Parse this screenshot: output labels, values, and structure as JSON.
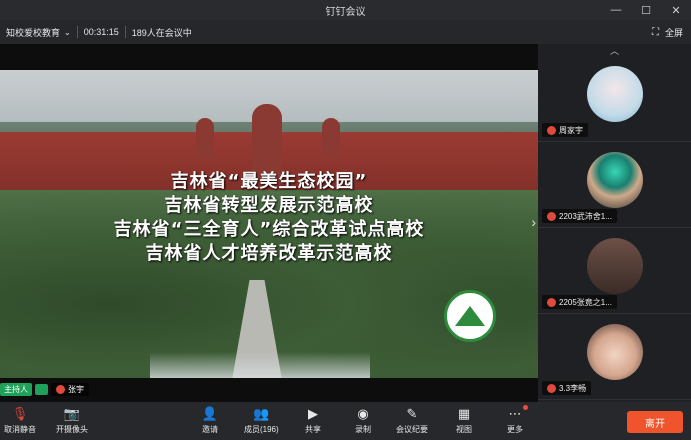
{
  "window": {
    "title": "钉钉会议"
  },
  "infobar": {
    "org": "知校爱校教育",
    "duration": "00:31:15",
    "attendees": "189人在会议中",
    "fullscreen": "全屏"
  },
  "video": {
    "lines": [
      "吉林省“最美生态校园”",
      "吉林省转型发展示范高校",
      "吉林省“三全育人”综合改革试点高校",
      "吉林省人才培养改革示范高校"
    ]
  },
  "speaker": {
    "host_badge": "主持人",
    "name": "张宇"
  },
  "participants": [
    {
      "name": "周家宇"
    },
    {
      "name": "2203武沛舍1..."
    },
    {
      "name": "2205张竟之1..."
    },
    {
      "name": "3.3李畅"
    }
  ],
  "toolbar": {
    "unmute": "取消静音",
    "camera": "开摄像头",
    "invite": "邀请",
    "members": "成员(196)",
    "share": "共享",
    "record": "录制",
    "minutes": "会议纪要",
    "view": "视图",
    "more": "更多",
    "leave": "离开"
  },
  "colors": {
    "leave": "#f0542d",
    "host": "#1fa15a",
    "mic_off": "#e04a3c"
  }
}
